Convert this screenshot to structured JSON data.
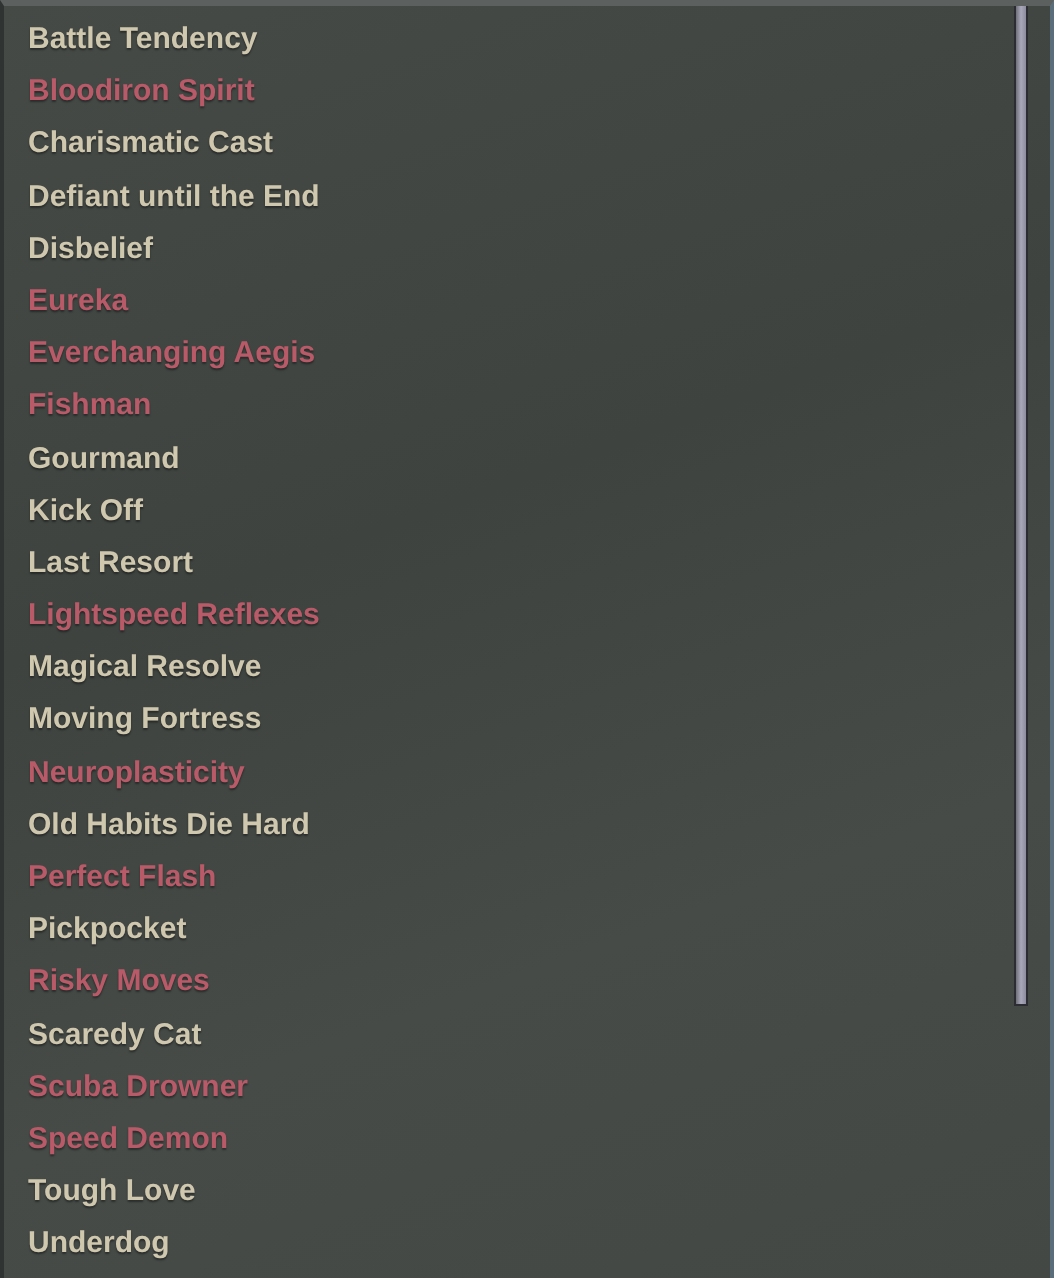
{
  "items": [
    {
      "label": "Battle Tendency",
      "color": "#cfc7ae"
    },
    {
      "label": "Bloodiron Spirit",
      "color": "#b85a68"
    },
    {
      "label": "Charismatic Cast",
      "color": "#cfc7ae"
    },
    {
      "label": "Defiant until the End",
      "color": "#cfc7ae"
    },
    {
      "label": "Disbelief",
      "color": "#cfc7ae"
    },
    {
      "label": "Eureka",
      "color": "#b85a68"
    },
    {
      "label": "Everchanging Aegis",
      "color": "#b85a68"
    },
    {
      "label": "Fishman",
      "color": "#b85a68"
    },
    {
      "label": "Gourmand",
      "color": "#cfc7ae"
    },
    {
      "label": "Kick Off",
      "color": "#cfc7ae"
    },
    {
      "label": "Last Resort",
      "color": "#cfc7ae"
    },
    {
      "label": "Lightspeed Reflexes",
      "color": "#b85a68"
    },
    {
      "label": "Magical Resolve",
      "color": "#cfc7ae"
    },
    {
      "label": "Moving Fortress",
      "color": "#cfc7ae"
    },
    {
      "label": "Neuroplasticity",
      "color": "#b85a68"
    },
    {
      "label": "Old Habits Die Hard",
      "color": "#cfc7ae"
    },
    {
      "label": "Perfect Flash",
      "color": "#b85a68"
    },
    {
      "label": "Pickpocket",
      "color": "#cfc7ae"
    },
    {
      "label": "Risky Moves",
      "color": "#b85a68"
    },
    {
      "label": "Scaredy Cat",
      "color": "#cfc7ae"
    },
    {
      "label": "Scuba Drowner",
      "color": "#b85a68"
    },
    {
      "label": "Speed Demon",
      "color": "#b85a68"
    },
    {
      "label": "Tough Love",
      "color": "#cfc7ae"
    },
    {
      "label": "Underdog",
      "color": "#cfc7ae"
    }
  ]
}
